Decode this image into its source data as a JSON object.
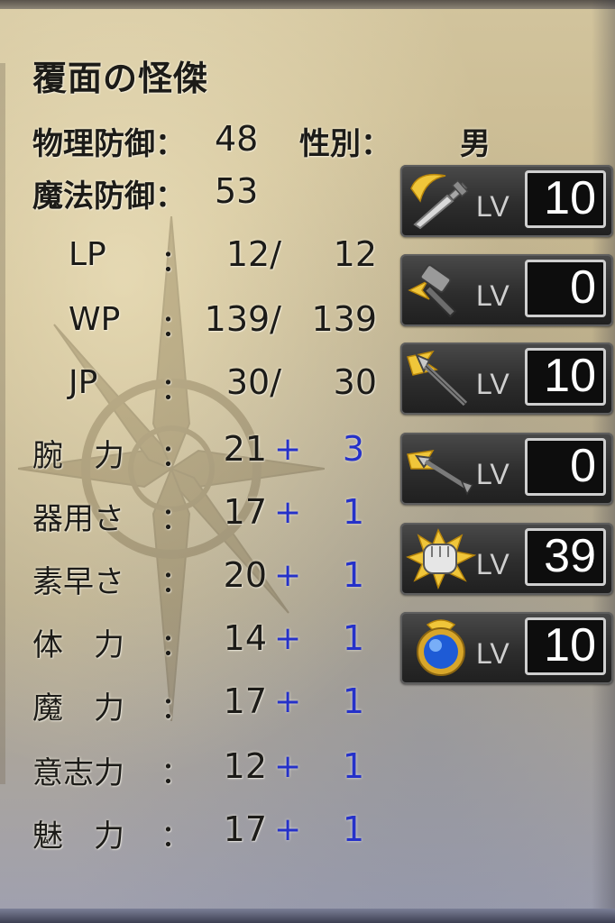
{
  "character": {
    "name": "覆面の怪傑"
  },
  "info": {
    "phys_def_label": "物理防御：",
    "phys_def_value": "48",
    "gender_label": "性別：",
    "gender_value": "男",
    "mag_def_label": "魔法防御：",
    "mag_def_value": "53"
  },
  "points": [
    {
      "label": "LP",
      "sep": "：",
      "current": "12/",
      "max": "12"
    },
    {
      "label": "WP",
      "sep": "：",
      "current": "139/",
      "max": "139"
    },
    {
      "label": "JP",
      "sep": "：",
      "current": "30/",
      "max": "30"
    }
  ],
  "stats": [
    {
      "label": "腕　力",
      "sep": "：",
      "base": "21",
      "plus": "+",
      "bonus": "3"
    },
    {
      "label": "器用さ",
      "sep": "：",
      "base": "17",
      "plus": "+",
      "bonus": "1"
    },
    {
      "label": "素早さ",
      "sep": "：",
      "base": "20",
      "plus": "+",
      "bonus": "1"
    },
    {
      "label": "体　力",
      "sep": "：",
      "base": "14",
      "plus": "+",
      "bonus": "1"
    },
    {
      "label": "魔　力",
      "sep": "：",
      "base": "17",
      "plus": "+",
      "bonus": "1"
    },
    {
      "label": "意志力",
      "sep": "：",
      "base": "12",
      "plus": "+",
      "bonus": "1"
    },
    {
      "label": "魅　力",
      "sep": "：",
      "base": "17",
      "plus": "+",
      "bonus": "1"
    }
  ],
  "skills": [
    {
      "icon": "sword-icon",
      "lv_label": "LV",
      "level": "10"
    },
    {
      "icon": "hammer-icon",
      "lv_label": "LV",
      "level": "0"
    },
    {
      "icon": "spear-icon",
      "lv_label": "LV",
      "level": "10"
    },
    {
      "icon": "arrow-icon",
      "lv_label": "LV",
      "level": "0"
    },
    {
      "icon": "fist-icon",
      "lv_label": "LV",
      "level": "39"
    },
    {
      "icon": "magic-orb-icon",
      "lv_label": "LV",
      "level": "10"
    }
  ],
  "colors": {
    "bonus_blue": "#2531c9",
    "text_dark": "#1c1b18",
    "skill_panel": "#2d2d2d"
  }
}
